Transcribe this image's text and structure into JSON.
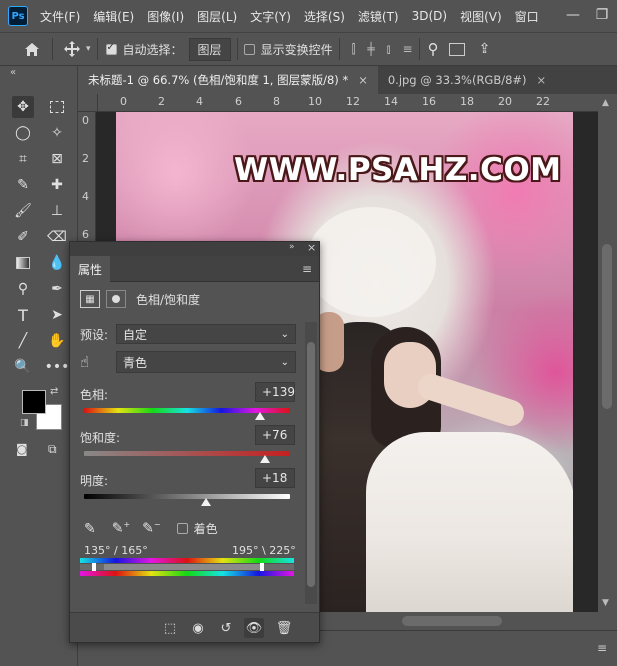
{
  "menubar": {
    "logo": "Ps",
    "items": [
      "文件(F)",
      "编辑(E)",
      "图像(I)",
      "图层(L)",
      "文字(Y)",
      "选择(S)",
      "滤镜(T)",
      "3D(D)",
      "视图(V)",
      "窗口"
    ]
  },
  "options": {
    "auto_select_label": "自动选择：",
    "auto_select_value": "图层",
    "show_transform_label": "显示变换控件"
  },
  "tabs": [
    {
      "label": "未标题-1 @ 66.7% (色相/饱和度 1, 图层蒙版/8) *",
      "close": "×"
    },
    {
      "label": "0.jpg @ 33.3%(RGB/8#)",
      "close": "×"
    }
  ],
  "ruler": {
    "h_labels": [
      "0",
      "2",
      "4",
      "6",
      "8",
      "10",
      "12",
      "14",
      "16",
      "18",
      "20",
      "22"
    ],
    "v_labels": [
      "0",
      "2",
      "4",
      "6"
    ]
  },
  "canvas": {
    "watermark": "WWW.PSAHZ.COM"
  },
  "panel": {
    "tab": "属性",
    "type_label": "色相/饱和度",
    "preset_label": "预设:",
    "preset_value": "自定",
    "channel_value": "青色",
    "hue_label": "色相:",
    "hue_value": "+139",
    "hue_level": 0.855,
    "saturation_label": "饱和度:",
    "saturation_value": "+76",
    "saturation_level": 0.88,
    "lightness_label": "明度:",
    "lightness_value": "+18",
    "lightness_level": 0.59,
    "colorize_label": "着色",
    "range_left": "135° / 165°",
    "range_right": "195° \\ 225°"
  }
}
